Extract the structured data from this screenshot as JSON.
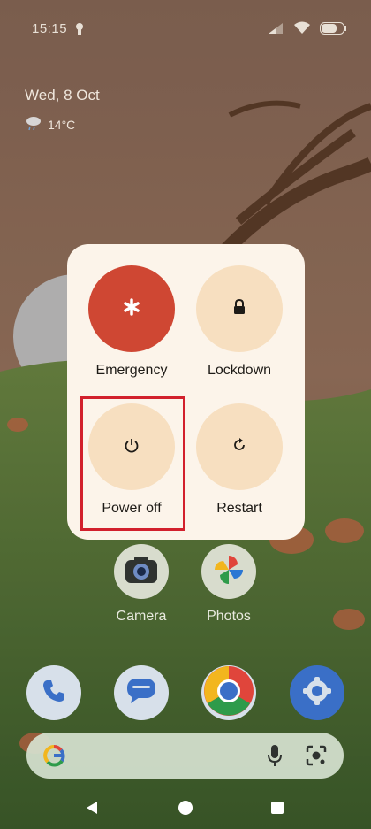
{
  "status": {
    "time": "15:15"
  },
  "lockscreen": {
    "date": "Wed, 8 Oct",
    "temperature": "14°C"
  },
  "power_menu": {
    "emergency_label": "Emergency",
    "lockdown_label": "Lockdown",
    "power_off_label": "Power off",
    "restart_label": "Restart"
  },
  "apps": {
    "camera_label": "Camera",
    "photos_label": "Photos"
  },
  "dock": [
    "phone",
    "messages",
    "chrome",
    "settings"
  ],
  "colors": {
    "emergency": "#cf4733",
    "menu_button": "#f7dfc0",
    "menu_bg": "#fcf4ea",
    "highlight": "#d2202c"
  }
}
